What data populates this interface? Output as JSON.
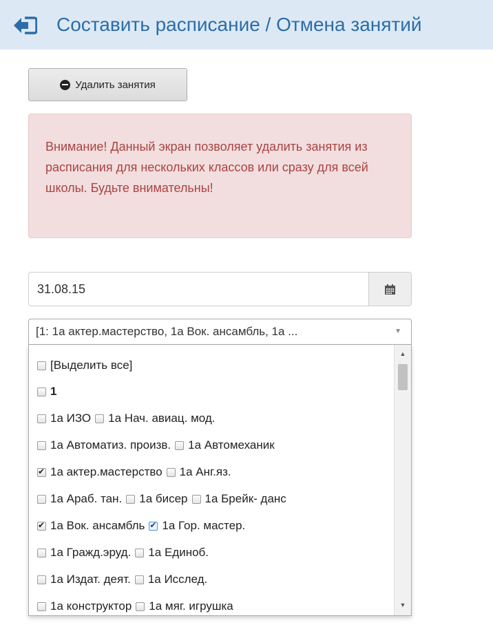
{
  "header": {
    "title": "Составить расписание / Отмена занятий",
    "back_icon": "sign-out-left-icon"
  },
  "toolbar": {
    "delete_label": "Удалить занятия"
  },
  "alert": {
    "text": "Внимание! Данный экран позволяет удалить занятия из расписания для нескольких классов или сразу для всей школы. Будьте внимательны!"
  },
  "date": {
    "value": "31.08.15",
    "icon": "calendar-icon"
  },
  "select": {
    "summary": "[1: 1а актер.мастерство, 1а Вок. ансамбль, 1а ..."
  },
  "dropdown": {
    "select_all": "[Выделить все]",
    "group": "1",
    "rows": [
      [
        {
          "label": "1а ИЗО",
          "checked": false
        },
        {
          "label": "1а Нач. авиац. мод.",
          "checked": false
        }
      ],
      [
        {
          "label": "1а Автоматиз. произв.",
          "checked": false
        },
        {
          "label": "1а Автомеханик",
          "checked": false
        }
      ],
      [
        {
          "label": "1а актер.мастерство",
          "checked": true
        },
        {
          "label": "1а Анг.яз.",
          "checked": false
        }
      ],
      [
        {
          "label": "1а Араб. тан.",
          "checked": false
        },
        {
          "label": "1а бисер",
          "checked": false
        },
        {
          "label": "1а Брейк- данс",
          "checked": false
        }
      ],
      [
        {
          "label": "1а Вок. ансамбль",
          "checked": true
        },
        {
          "label": "1а Гор. мастер.",
          "checked": true
        }
      ],
      [
        {
          "label": "1а Гражд.эруд.",
          "checked": false
        },
        {
          "label": "1а Единоб.",
          "checked": false
        }
      ],
      [
        {
          "label": "1а Издат. деят.",
          "checked": false
        },
        {
          "label": "1а Исслед.",
          "checked": false
        }
      ],
      [
        {
          "label": "1а конструктор",
          "checked": false
        },
        {
          "label": "1а мяг. игрушка",
          "checked": false
        }
      ]
    ]
  }
}
